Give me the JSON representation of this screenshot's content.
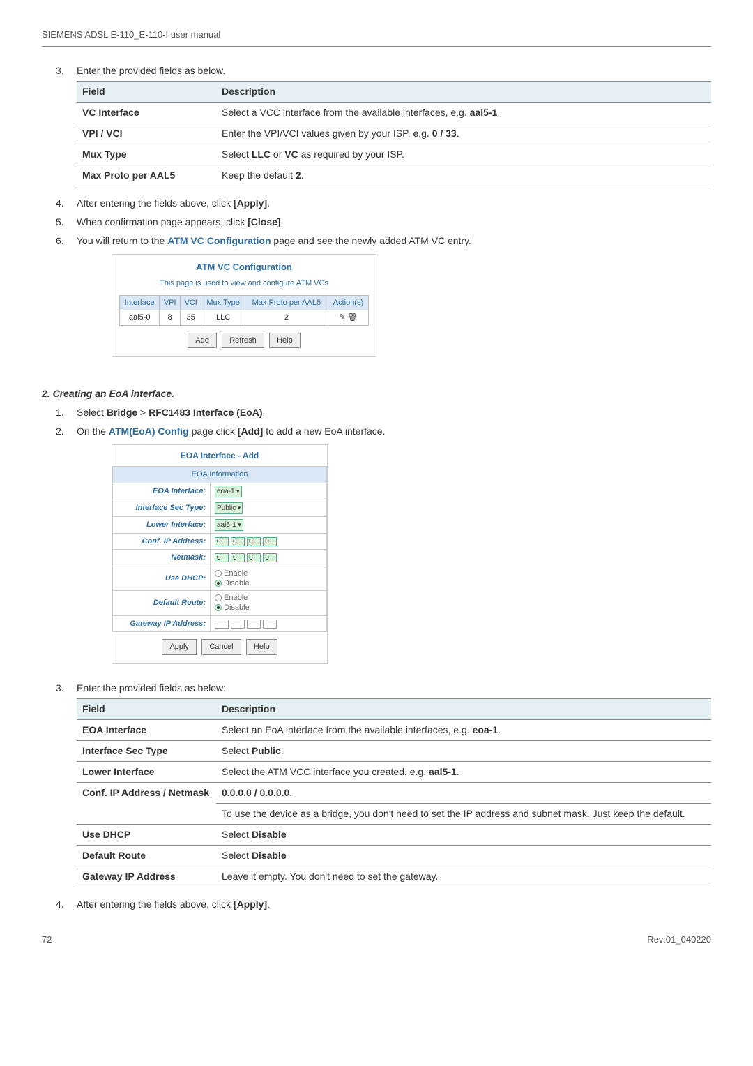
{
  "header": "SIEMENS ADSL E-110_E-110-I user manual",
  "step3": {
    "num": "3.",
    "text": "Enter the provided fields as below.",
    "th_field": "Field",
    "th_desc": "Description",
    "rows": [
      {
        "f": "VC Interface",
        "d_pre": "Select a VCC interface from the available interfaces, e.g. ",
        "d_bold": "aal5-1",
        "d_post": "."
      },
      {
        "f": "VPI / VCI",
        "d_pre": "Enter the VPI/VCI values given by your ISP, e.g. ",
        "d_bold": "0 / 33",
        "d_post": "."
      },
      {
        "f": "Mux Type",
        "d_pre": "Select ",
        "d_bold": "LLC",
        "d_mid": " or ",
        "d_bold2": "VC",
        "d_post": " as required by your ISP."
      },
      {
        "f": "Max Proto per AAL5",
        "d_pre": "Keep the default ",
        "d_bold": "2",
        "d_post": "."
      }
    ]
  },
  "step4": {
    "num": "4.",
    "pre": "After entering the fields above, click ",
    "bold": "[Apply]",
    "post": "."
  },
  "step5": {
    "num": "5.",
    "pre": "When confirmation page appears, click ",
    "bold": "[Close]",
    "post": "."
  },
  "step6": {
    "num": "6.",
    "pre": "You will return to the ",
    "link": "ATM VC Configuration",
    "post": " page and see the newly added ATM VC entry."
  },
  "atm": {
    "title": "ATM VC Configuration",
    "sub": "This page is used to view and configure ATM VCs",
    "th": [
      "Interface",
      "VPI",
      "VCI",
      "Mux Type",
      "Max Proto per AAL5",
      "Action(s)"
    ],
    "row": [
      "aal5-0",
      "8",
      "35",
      "LLC",
      "2"
    ],
    "action_edit": "✎",
    "action_del": "🗑",
    "btn_add": "Add",
    "btn_refresh": "Refresh",
    "btn_help": "Help"
  },
  "section2": {
    "title": "2. Creating an EoA interface.",
    "s1": {
      "num": "1.",
      "pre": "Select ",
      "b1": "Bridge",
      "mid": " > ",
      "b2": "RFC1483 Interface (EoA)",
      "post": "."
    },
    "s2": {
      "num": "2.",
      "pre": "On the ",
      "link": "ATM(EoA) Config",
      "mid": " page click ",
      "bold": "[Add]",
      "post": " to add a new EoA interface."
    }
  },
  "eoa": {
    "title": "EOA Interface - Add",
    "info": "EOA Information",
    "rows": {
      "eoa_if_l": "EOA Interface:",
      "eoa_if_v": "eoa-1",
      "sec_l": "Interface Sec Type:",
      "sec_v": "Public",
      "low_l": "Lower Interface:",
      "low_v": "aal5-1",
      "ip_l": "Conf. IP Address:",
      "nm_l": "Netmask:",
      "dhcp_l": "Use DHCP:",
      "en": "Enable",
      "dis": "Disable",
      "dr_l": "Default Route:",
      "gw_l": "Gateway IP Address:"
    },
    "ip0": "0",
    "btn_apply": "Apply",
    "btn_cancel": "Cancel",
    "btn_help": "Help"
  },
  "step3b": {
    "num": "3.",
    "text": "Enter the provided fields as below:",
    "th_field": "Field",
    "th_desc": "Description",
    "rows": [
      {
        "f": "EOA Interface",
        "d_pre": "Select an EoA interface from the available interfaces, e.g. ",
        "d_bold": "eoa-1",
        "d_post": "."
      },
      {
        "f": "Interface Sec Type",
        "d_pre": "Select ",
        "d_bold": "Public",
        "d_post": "."
      },
      {
        "f": "Lower Interface",
        "d_pre": "Select the ATM VCC interface you created, e.g. ",
        "d_bold": "aal5-1",
        "d_post": "."
      },
      {
        "f": "Conf. IP Address / Netmask",
        "d_bold_top": "0.0.0.0 / 0.0.0.0",
        "d_post_top": ".",
        "d2": "To use the device as a bridge, you don't need to set the IP address and subnet mask. Just keep the default."
      },
      {
        "f": "Use DHCP",
        "d_pre": "Select ",
        "d_bold": "Disable"
      },
      {
        "f": "Default Route",
        "d_pre": "Select ",
        "d_bold": "Disable"
      },
      {
        "f": "Gateway IP Address",
        "d_pre": "Leave it empty. You don't need to set the gateway."
      }
    ]
  },
  "step4b": {
    "num": "4.",
    "pre": "After entering the fields above, click ",
    "bold": "[Apply]",
    "post": "."
  },
  "footer": {
    "page": "72",
    "rev": "Rev:01_040220"
  }
}
